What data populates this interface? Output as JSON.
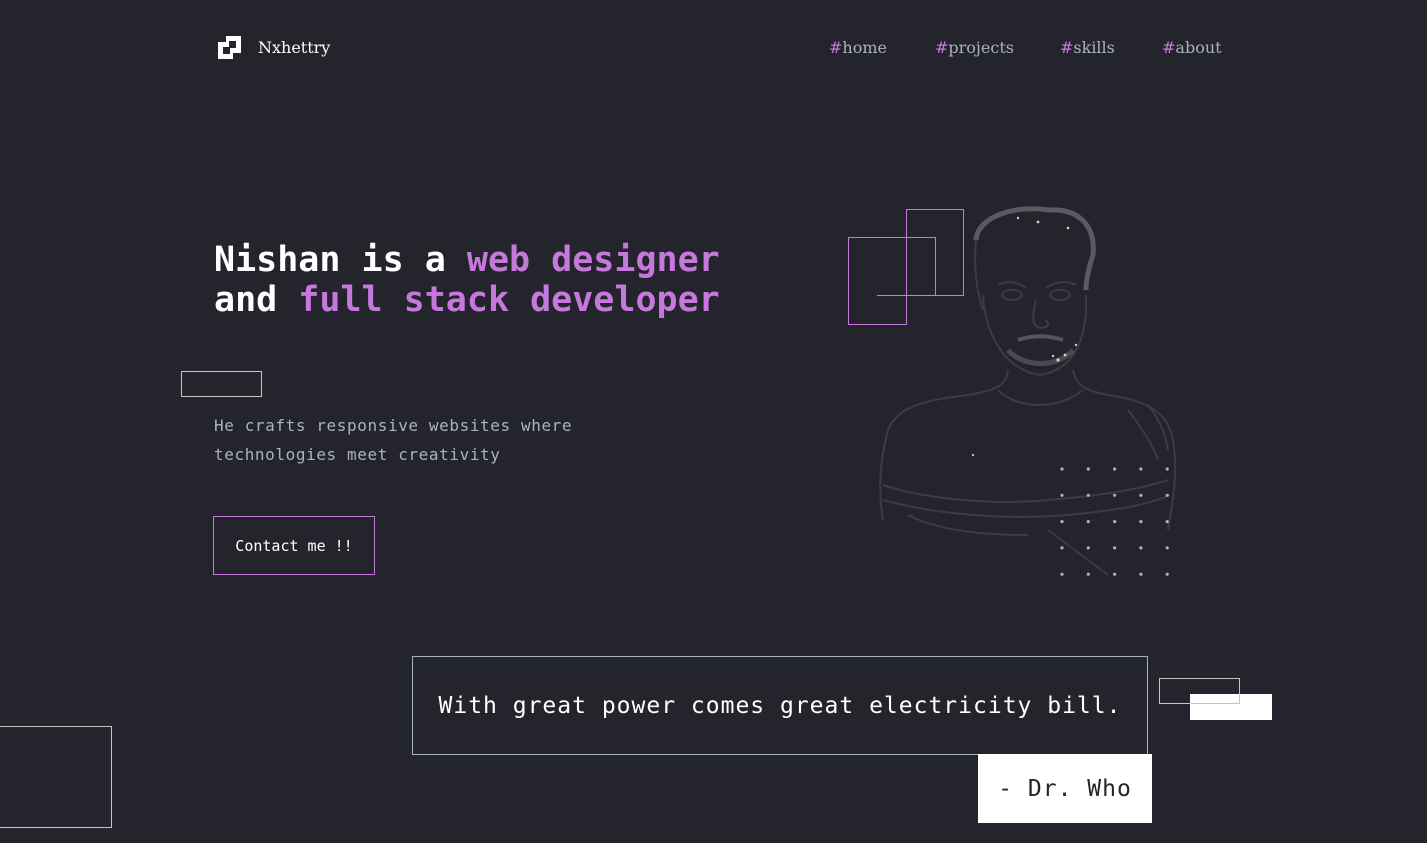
{
  "header": {
    "brand": "Nxhettry",
    "logo_icon": "nxhettry-logo-icon",
    "nav": [
      {
        "hash": "#",
        "label": "home"
      },
      {
        "hash": "#",
        "label": "projects"
      },
      {
        "hash": "#",
        "label": "skills"
      },
      {
        "hash": "#",
        "label": "about"
      }
    ]
  },
  "hero": {
    "title_parts": {
      "p1": "Nishan is a ",
      "h1": "web designer",
      "p2": " and ",
      "h2": "full stack developer"
    },
    "subtitle": "He crafts responsive websites where technologies meet creativity",
    "cta_label": "Contact me !!",
    "illustration": "portrait-sketch-image"
  },
  "quote": {
    "text": "With great power comes great electricity bill.",
    "author": "- Dr. Who"
  },
  "colors": {
    "background": "#24242d",
    "accent": "#c778dd",
    "text": "#ffffff",
    "muted": "#abb2bf"
  }
}
